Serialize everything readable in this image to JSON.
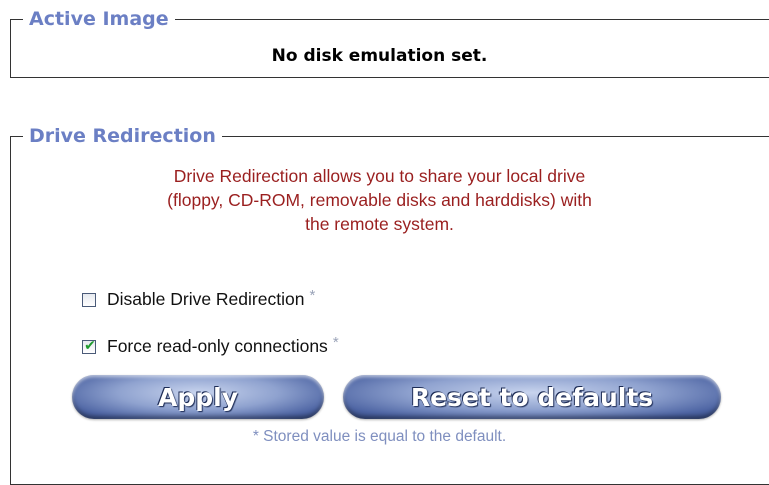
{
  "active_image": {
    "legend": "Active Image",
    "status": "No disk emulation set."
  },
  "drive_redirection": {
    "legend": "Drive Redirection",
    "description_lines": [
      "Drive Redirection allows you to share your local drive",
      "(floppy, CD-ROM, removable disks and harddisks) with",
      "the remote system."
    ],
    "options": [
      {
        "label": "Disable Drive Redirection",
        "marker": "*",
        "checked": false
      },
      {
        "label": "Force read-only connections",
        "marker": "*",
        "checked": true
      }
    ],
    "buttons": {
      "apply": "Apply",
      "reset": "Reset to defaults"
    },
    "note": "* Stored value is equal to the default."
  },
  "colors": {
    "legend": "#6b7fc4",
    "description": "#9a1f1f",
    "button": "#4d64a3",
    "check": "#1e9a2e"
  }
}
